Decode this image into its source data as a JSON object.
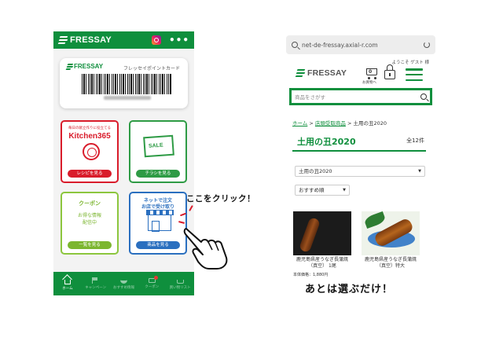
{
  "left_app": {
    "header": {
      "brand": "FRESSAY",
      "menu_glyph": "•••"
    },
    "point_card": {
      "brand": "FRESSAY",
      "title": "フレッセイポイントカード"
    },
    "tiles": {
      "kitchen": {
        "subtitle": "毎日の献立作りに役立てる",
        "name": "Kitchen365",
        "button": "レシピを見る",
        "color": "#d91c2b"
      },
      "sale": {
        "sign": "SALE",
        "button": "チラシを見る",
        "color": "#2e9b45"
      },
      "coupon": {
        "title": "クーポン",
        "body_line1": "お得な情報",
        "body_line2": "配信中",
        "button": "一覧を見る",
        "color": "#8cc63e"
      },
      "net": {
        "title_line1": "ネットで注文",
        "title_line2": "お店で受け取り",
        "button": "商品を見る",
        "color": "#2a6fbf"
      }
    },
    "tabbar": [
      {
        "label": "ホーム",
        "icon": "home-icon"
      },
      {
        "label": "キャンペーン",
        "icon": "flag-icon"
      },
      {
        "label": "おすすめ情報",
        "icon": "bowl-icon"
      },
      {
        "label": "クーポン",
        "icon": "coupon-icon"
      },
      {
        "label": "買い物リスト",
        "icon": "basket-icon"
      }
    ],
    "brand_color": "#0f8f3d"
  },
  "annotations": {
    "click_here": "ここをクリック！",
    "then_choose": "あとは選ぶだけ！"
  },
  "web": {
    "url": "net-de-fressay.axial-r.com",
    "welcome": "ようこそ ゲスト 様",
    "brand": "FRESSAY",
    "cart_count": "0",
    "cart_label": "お買物へ",
    "search_placeholder": "商品をさがす",
    "breadcrumb": {
      "home": "ホーム",
      "sep1": " > ",
      "category": "店頭受取商品",
      "sep2": " > ",
      "current": "土用の丑2020"
    },
    "page_title": "土用の丑2020",
    "count": "全12件",
    "category_select": "土用の丑2020",
    "sort_select": "おすすめ順",
    "products": [
      {
        "name_line1": "鹿児島県産うなぎ長蒲焼",
        "name_line2": "（真空） 1尾",
        "price": "本体価格：1,880円"
      },
      {
        "name_line1": "鹿児島県産うなぎ長蒲焼",
        "name_line2": "（真空）特大",
        "price": ""
      }
    ]
  }
}
